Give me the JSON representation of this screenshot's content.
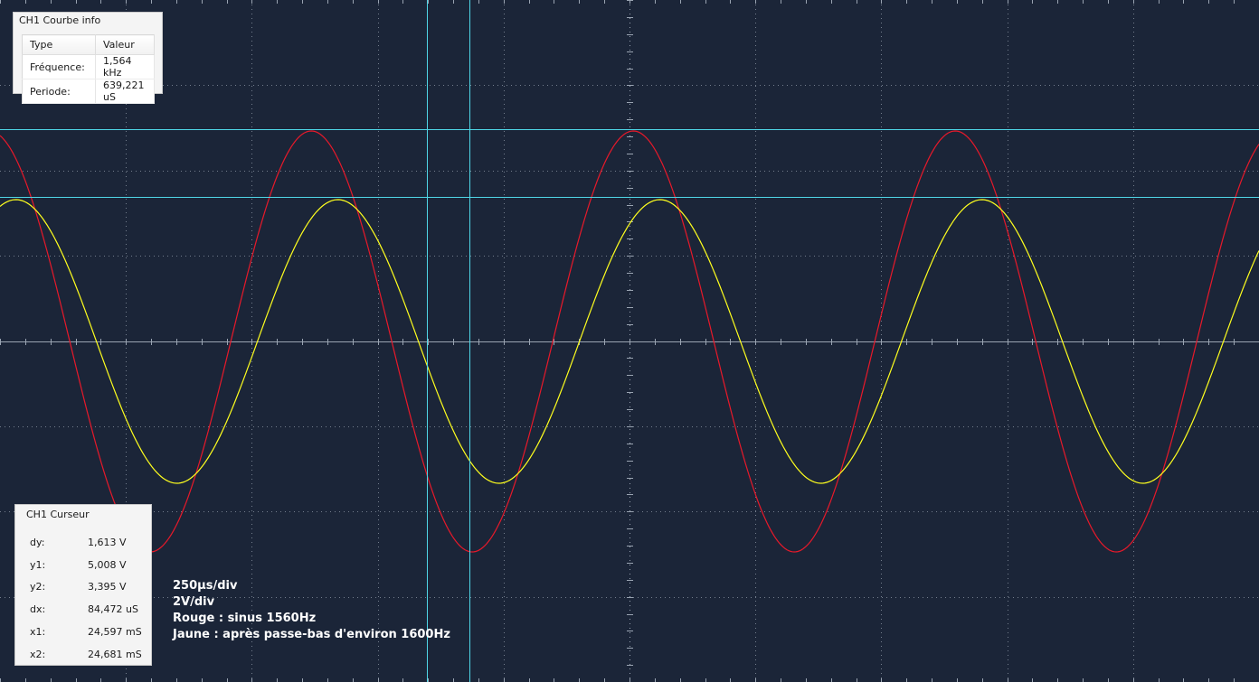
{
  "colors": {
    "background": "#1b2538",
    "grid": "#9aa4b2",
    "cursor": "#4fd6e6",
    "ch1": "#e8192a",
    "ch2": "#ffff1e"
  },
  "info_panel": {
    "title": "CH1 Courbe info",
    "headers": [
      "Type",
      "Valeur"
    ],
    "rows": [
      {
        "label": "Fréquence:",
        "value": "1,564 kHz"
      },
      {
        "label": "Periode:",
        "value": "639,221 uS"
      }
    ]
  },
  "cursor_panel": {
    "title": "CH1 Curseur",
    "rows": [
      {
        "label": "dy:",
        "value": "1,613 V"
      },
      {
        "label": "y1:",
        "value": "5,008 V"
      },
      {
        "label": "y2:",
        "value": "3,395 V"
      },
      {
        "label": "dx:",
        "value": "84,472 uS"
      },
      {
        "label": "x1:",
        "value": "24,597 mS"
      },
      {
        "label": "x2:",
        "value": "24,681 mS"
      }
    ]
  },
  "annotations": [
    "250µs/div",
    "2V/div",
    "Rouge : sinus 1560Hz",
    "Jaune : après passe-bas d'environ 1600Hz"
  ],
  "chart_data": {
    "type": "line",
    "title": "",
    "xlabel": "",
    "ylabel": "",
    "x_scale": "250µs/div",
    "y_scale": "2V/div",
    "grid": true,
    "series": [
      {
        "name": "Rouge : sinus 1560Hz",
        "color": "#e8192a",
        "frequency_hz": 1564,
        "period_us": 639.221,
        "amplitude_divisions": 5.1,
        "offset_divisions": 0
      },
      {
        "name": "Jaune : après passe-bas d'environ 1600Hz",
        "color": "#ffff1e",
        "frequency_hz": 1564,
        "period_us": 639.221,
        "amplitude_divisions": 3.3,
        "offset_divisions": 0
      }
    ],
    "cursors": {
      "x1_ms": 24.597,
      "x2_ms": 24.681,
      "dx_us": 84.472,
      "y1_v": 5.008,
      "y2_v": 3.395,
      "dy_v": 1.613
    }
  }
}
